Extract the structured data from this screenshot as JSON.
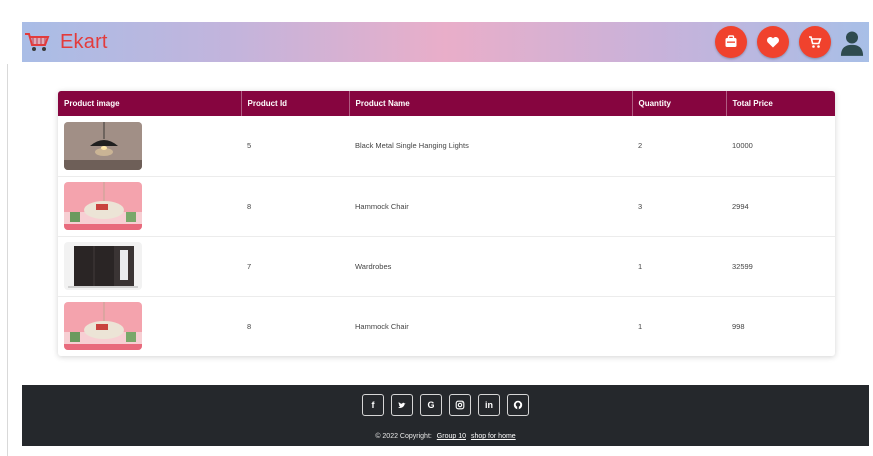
{
  "header": {
    "brand_name": "Ekart",
    "actions": [
      {
        "icon": "orders-icon"
      },
      {
        "icon": "heart-icon"
      },
      {
        "icon": "cart-icon"
      }
    ],
    "accent_color": "#f0422d"
  },
  "table": {
    "columns": [
      "Product image",
      "Product Id",
      "Product Name",
      "Quantity",
      "Total Price"
    ],
    "rows": [
      {
        "image": "hanging-light-image",
        "id": "5",
        "name": "Black Metal Single Hanging Lights",
        "quantity": "2",
        "total": "10000"
      },
      {
        "image": "hammock-chair-image",
        "id": "8",
        "name": "Hammock Chair",
        "quantity": "3",
        "total": "2994"
      },
      {
        "image": "wardrobe-image",
        "id": "7",
        "name": "Wardrobes",
        "quantity": "1",
        "total": "32599"
      },
      {
        "image": "hammock-chair-image",
        "id": "8",
        "name": "Hammock Chair",
        "quantity": "1",
        "total": "998"
      }
    ],
    "header_color": "#86053f"
  },
  "footer": {
    "social": [
      "f",
      "twitter-icon",
      "G",
      "instagram-icon",
      "in",
      "github-icon"
    ],
    "copyright_prefix": "© 2022 Copyright:",
    "link_1": "Group 10",
    "link_2": "shop for home"
  }
}
